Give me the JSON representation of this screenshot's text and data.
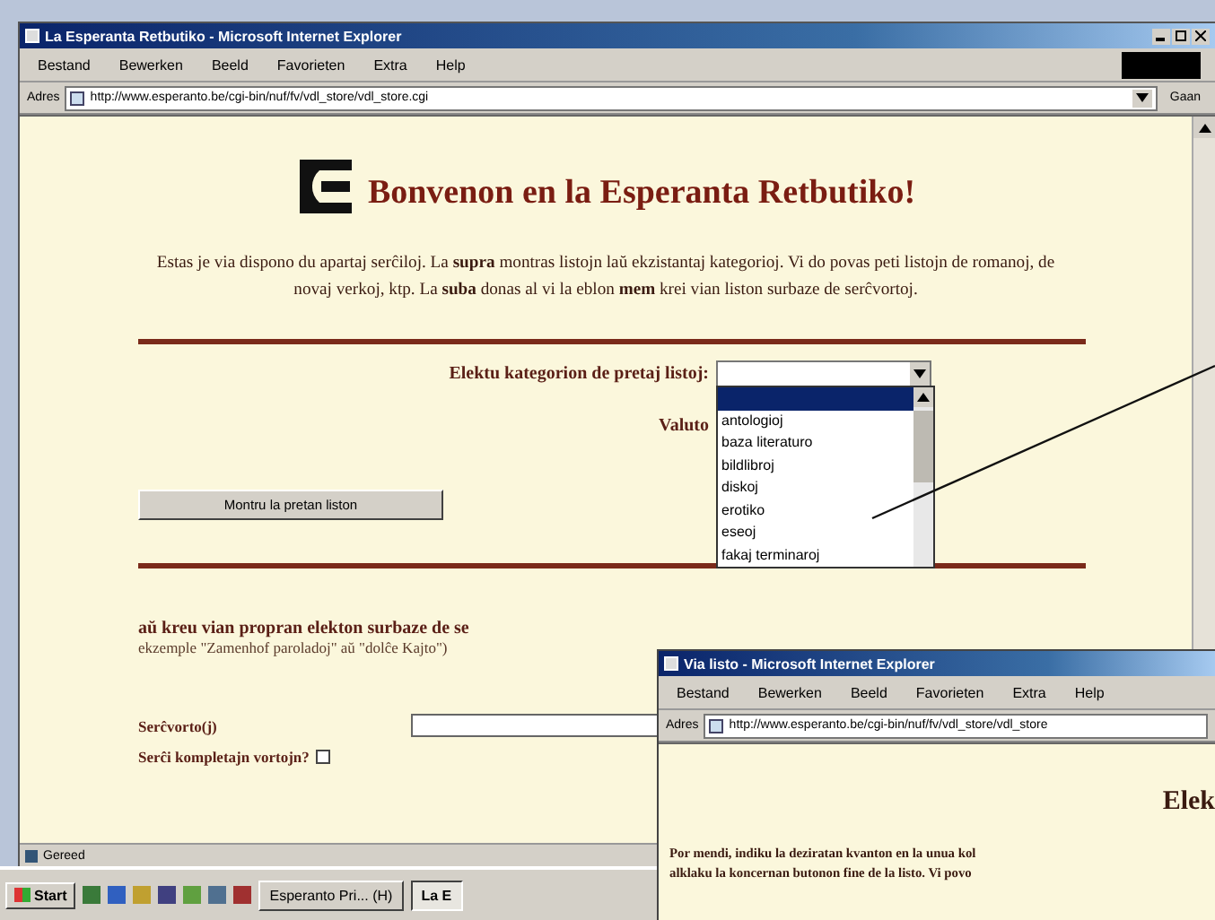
{
  "main_window": {
    "title": "La Esperanta Retbutiko - Microsoft Internet Explorer",
    "menu": [
      "Bestand",
      "Bewerken",
      "Beeld",
      "Favorieten",
      "Extra",
      "Help"
    ],
    "address_label": "Adres",
    "url": "http://www.esperanto.be/cgi-bin/nuf/fv/vdl_store/vdl_store.cgi",
    "go_button": "Gaan",
    "heading": "Bonvenon en la Esperanta Retbutiko!",
    "intro": "Estas je via dispono du apartaj serĉiloj. La **supra** montras listojn laŭ ekzistantaj kategorioj. Vi do povas peti listojn de romanoj, de novaj verkoj, ktp. La **suba** donas al vi la eblon **mem** krei vian liston surbaze de serĉvortoj.",
    "category_label": "Elektu kategorion de pretaj listoj:",
    "category_options": [
      {
        "selected": true
      },
      {
        "label": "antologioj",
        "selected": false
      },
      {
        "label": "baza literaturo",
        "selected": false
      },
      {
        "label": "bildlibroj",
        "selected": false
      },
      {
        "label": "diskoj",
        "selected": false
      },
      {
        "label": "erotiko",
        "selected": false
      },
      {
        "label": "eseoj",
        "selected": false
      },
      {
        "label": "fakaj terminaroj",
        "selected": false
      }
    ],
    "currency_label": "Valuto",
    "show_button": "Montru la pretan liston",
    "search_heading": "aŭ kreu vian propran elekton surbaze de se",
    "search_hint": "ekzemple \"Zamenhof paroladoj\" aŭ \"dolĉe Kajto\")",
    "keyword_label": "Serĉvorto(j)",
    "whole_words_label": "Serĉi kompletajn vortojn?",
    "whole_words_checked": false,
    "status": "Gereed"
  },
  "second_window": {
    "title": "Via listo - Microsoft Internet Explorer",
    "menu": [
      "Bestand",
      "Bewerken",
      "Beeld",
      "Favorieten",
      "Extra",
      "Help"
    ],
    "address_label": "Adres",
    "url": "http://www.esperanto.be/cgi-bin/nuf/fv/vdl_store/vdl_store",
    "heading": "Elek",
    "lines": [
      "Por mendi, indiku la deziratan kvanton en la unua kol",
      "alklaku la koncernan butonon fine de la listo. Vi povo"
    ]
  },
  "taskbar": {
    "start": "Start",
    "tasks": [
      {
        "label": "Esperanto Pri... (H)",
        "selected": false
      },
      {
        "label": "La E",
        "selected": true
      }
    ]
  }
}
